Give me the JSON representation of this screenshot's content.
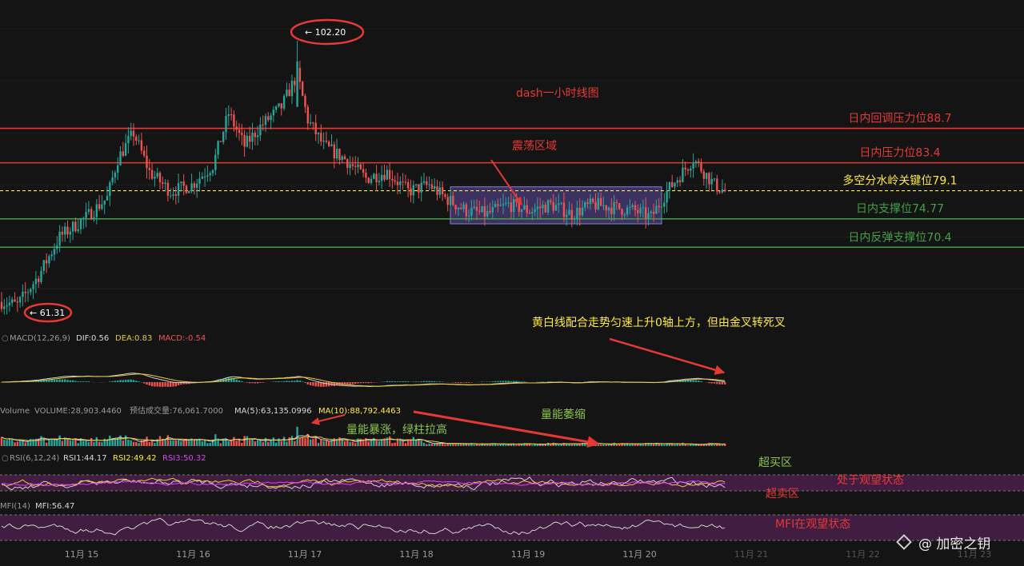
{
  "title": "dash一小时线图",
  "watermark": "@ 加密之钥",
  "colors": {
    "background": "#141414",
    "up": "#26a69a",
    "down": "#ef5350",
    "resistance_line": "#e53935",
    "key_line": "#ffeb3b",
    "support_line": "#43a047",
    "annotation_red": "#e53935",
    "annotation_green": "#8bc34a",
    "annotation_yellow": "#ffeb3b",
    "zone_fill": "#5c4aa0",
    "rsi_band": "#4a1f4a",
    "ma_white": "#d0d0d0",
    "ma_yellow": "#e8c63a"
  },
  "chart_data": {
    "type": "candlestick",
    "x_ticks": [
      "11月 15",
      "11月 16",
      "11月 17",
      "11月 18",
      "11月 19",
      "11月 20",
      "11月 21",
      "11月 22",
      "11月 23"
    ],
    "ylim": [
      58,
      106
    ],
    "anchor_points": [
      {
        "t": 0,
        "p": 62
      },
      {
        "t": 6,
        "p": 61.5
      },
      {
        "t": 14,
        "p": 66
      },
      {
        "t": 22,
        "p": 72
      },
      {
        "t": 32,
        "p": 75
      },
      {
        "t": 40,
        "p": 78
      },
      {
        "t": 44,
        "p": 84
      },
      {
        "t": 50,
        "p": 88
      },
      {
        "t": 56,
        "p": 82
      },
      {
        "t": 64,
        "p": 79
      },
      {
        "t": 72,
        "p": 80
      },
      {
        "t": 80,
        "p": 83
      },
      {
        "t": 86,
        "p": 91
      },
      {
        "t": 92,
        "p": 86
      },
      {
        "t": 98,
        "p": 89
      },
      {
        "t": 106,
        "p": 92
      },
      {
        "t": 112,
        "p": 97
      },
      {
        "t": 116,
        "p": 90
      },
      {
        "t": 122,
        "p": 86
      },
      {
        "t": 130,
        "p": 84
      },
      {
        "t": 138,
        "p": 81
      },
      {
        "t": 146,
        "p": 82
      },
      {
        "t": 154,
        "p": 79
      },
      {
        "t": 162,
        "p": 80
      },
      {
        "t": 168,
        "p": 78
      },
      {
        "t": 176,
        "p": 76
      },
      {
        "t": 184,
        "p": 75.5
      },
      {
        "t": 192,
        "p": 77
      },
      {
        "t": 200,
        "p": 76
      },
      {
        "t": 208,
        "p": 77
      },
      {
        "t": 216,
        "p": 75.5
      },
      {
        "t": 224,
        "p": 77
      },
      {
        "t": 232,
        "p": 76.5
      },
      {
        "t": 240,
        "p": 76
      },
      {
        "t": 246,
        "p": 75
      },
      {
        "t": 252,
        "p": 79
      },
      {
        "t": 258,
        "p": 82
      },
      {
        "t": 262,
        "p": 84
      },
      {
        "t": 266,
        "p": 82
      },
      {
        "t": 270,
        "p": 80
      },
      {
        "t": 274,
        "p": 79
      }
    ],
    "price_labels": {
      "high": "← 102.20",
      "low": "← 61.31",
      "high_value": 102.2,
      "low_value": 61.31
    },
    "levels": [
      {
        "label": "日内回调压力位88.7",
        "value": 88.7,
        "kind": "resistance"
      },
      {
        "label": "日内压力位83.4",
        "value": 83.4,
        "kind": "resistance"
      },
      {
        "label": "多空分水岭关键位79.1",
        "value": 79.1,
        "kind": "key"
      },
      {
        "label": "日内支撑位74.77",
        "value": 74.77,
        "kind": "support"
      },
      {
        "label": "日内反弹支撑位70.4",
        "value": 70.4,
        "kind": "support"
      }
    ],
    "consolidation_zone": {
      "label": "震荡区域",
      "t_start": 170,
      "t_end": 250,
      "p_low": 74.0,
      "p_high": 79.7
    },
    "macd": {
      "legend": "MACD(12,26,9)",
      "dif": "DIF:0.56",
      "dea": "DEA:0.83",
      "macd": "MACD:-0.54",
      "note": "黄白线配合走势匀速上升0轴上方，但由金叉转死叉"
    },
    "volume": {
      "legend": "Volume",
      "volume": "VOLUME:28,903.4460",
      "est": "预估成交量:76,061.7000",
      "ma5": "MA(5):63,135.0996",
      "ma10": "MA(10):88,792.4463",
      "note_surge": "量能暴涨，绿柱拉高",
      "note_shrink": "量能萎缩"
    },
    "rsi": {
      "legend": "RSI(6,12,24)",
      "rsi1": "RSI1:44.17",
      "rsi2": "RSI2:49.42",
      "rsi3": "RSI3:50.32",
      "overbought": "超买区",
      "oversold": "超卖区",
      "state": "处于观望状态"
    },
    "mfi": {
      "legend": "MFI(14)",
      "mfi": "MFI:56.47",
      "state": "MFI在观望状态"
    }
  }
}
